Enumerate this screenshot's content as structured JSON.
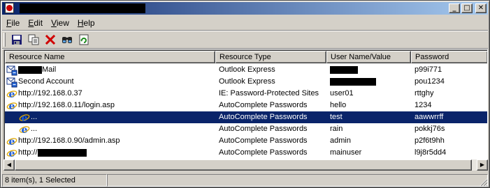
{
  "window": {
    "title": "",
    "buttons": {
      "minimize": "_",
      "maximize": "□",
      "close": "✕"
    }
  },
  "menu": [
    {
      "label": "File",
      "accel": "F",
      "rest": "ile"
    },
    {
      "label": "Edit",
      "accel": "E",
      "rest": "dit"
    },
    {
      "label": "View",
      "accel": "V",
      "rest": "iew"
    },
    {
      "label": "Help",
      "accel": "H",
      "rest": "elp"
    }
  ],
  "toolbar": {
    "buttons": [
      "save-icon",
      "copy-icon",
      "delete-icon",
      "find-icon",
      "refresh-icon"
    ]
  },
  "table": {
    "columns": [
      "Resource Name",
      "Resource Type",
      "User Name/Value",
      "Password"
    ],
    "rows": [
      {
        "icon": "outlook-icon",
        "indent": 0,
        "name_redacted": true,
        "name": "Mail",
        "type": "Outlook Express",
        "user": "",
        "user_redacted": true,
        "password": "p99i771",
        "selected": false
      },
      {
        "icon": "outlook-icon",
        "indent": 0,
        "name_redacted": false,
        "name": "Second Account",
        "type": "Outlook Express",
        "user": "",
        "user_redacted": true,
        "password": "pou1234",
        "selected": false
      },
      {
        "icon": "ie-icon",
        "indent": 0,
        "name_redacted": false,
        "name": "http://192.168.0.37",
        "type": "IE: Password-Protected Sites",
        "user": "user01",
        "user_redacted": false,
        "password": "rttghy",
        "selected": false
      },
      {
        "icon": "ie-icon",
        "indent": 0,
        "name_redacted": false,
        "name": "http://192.168.0.11/login.asp",
        "type": "AutoComplete Passwords",
        "user": "hello",
        "user_redacted": false,
        "password": "1234",
        "selected": false
      },
      {
        "icon": "ie-icon",
        "indent": 1,
        "name_redacted": false,
        "name": "...",
        "type": "AutoComplete Passwords",
        "user": "test",
        "user_redacted": false,
        "password": "aawwrrff",
        "selected": true
      },
      {
        "icon": "ie-icon",
        "indent": 1,
        "name_redacted": false,
        "name": "...",
        "type": "AutoComplete Passwords",
        "user": "rain",
        "user_redacted": false,
        "password": "pokkj76s",
        "selected": false
      },
      {
        "icon": "ie-icon",
        "indent": 0,
        "name_redacted": false,
        "name": "http://192.168.0.90/admin.asp",
        "type": "AutoComplete Passwords",
        "user": "admin",
        "user_redacted": false,
        "password": "p2f6t9hh",
        "selected": false
      },
      {
        "icon": "ie-icon",
        "indent": 0,
        "name_redacted": true,
        "name": "http://",
        "type": "AutoComplete Passwords",
        "user": "mainuser",
        "user_redacted": false,
        "password": "l9j8r5dd4",
        "selected": false
      }
    ]
  },
  "status": {
    "text": "8 item(s), 1 Selected"
  },
  "scroll": {
    "visible_fraction": 0.99
  },
  "colors": {
    "selection": "#0a246a",
    "face": "#d4d0c8"
  }
}
